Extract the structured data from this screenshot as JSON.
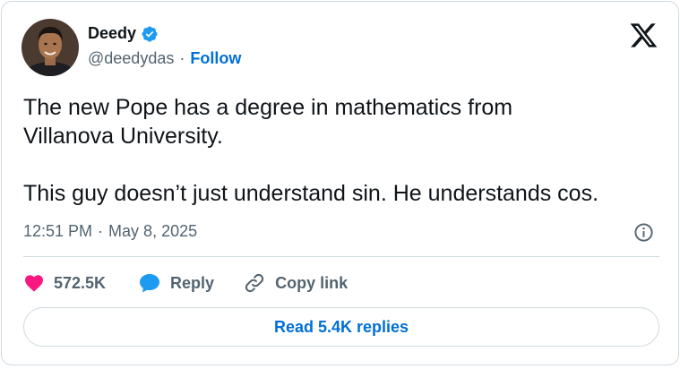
{
  "author": {
    "name": "Deedy",
    "handle": "@deedydas",
    "separator": "·",
    "follow_label": "Follow",
    "verified_color": "#1d9bf0"
  },
  "tweet": {
    "text": "The new Pope has a degree in mathematics from\nVillanova University.\n\nThis guy doesn’t just understand sin. He understands cos.",
    "time": "12:51 PM",
    "separator": "·",
    "date": "May 8, 2025"
  },
  "actions": {
    "like_count": "572.5K",
    "reply_label": "Reply",
    "copy_label": "Copy link"
  },
  "replies_button": "Read 5.4K replies",
  "colors": {
    "link": "#006fd6",
    "like": "#f91880",
    "reply": "#1d9bf0",
    "muted": "#536471",
    "border": "#cfd9de"
  },
  "icons": [
    "verified-badge-icon",
    "x-logo-icon",
    "info-icon",
    "heart-icon",
    "reply-bubble-icon",
    "link-icon"
  ]
}
